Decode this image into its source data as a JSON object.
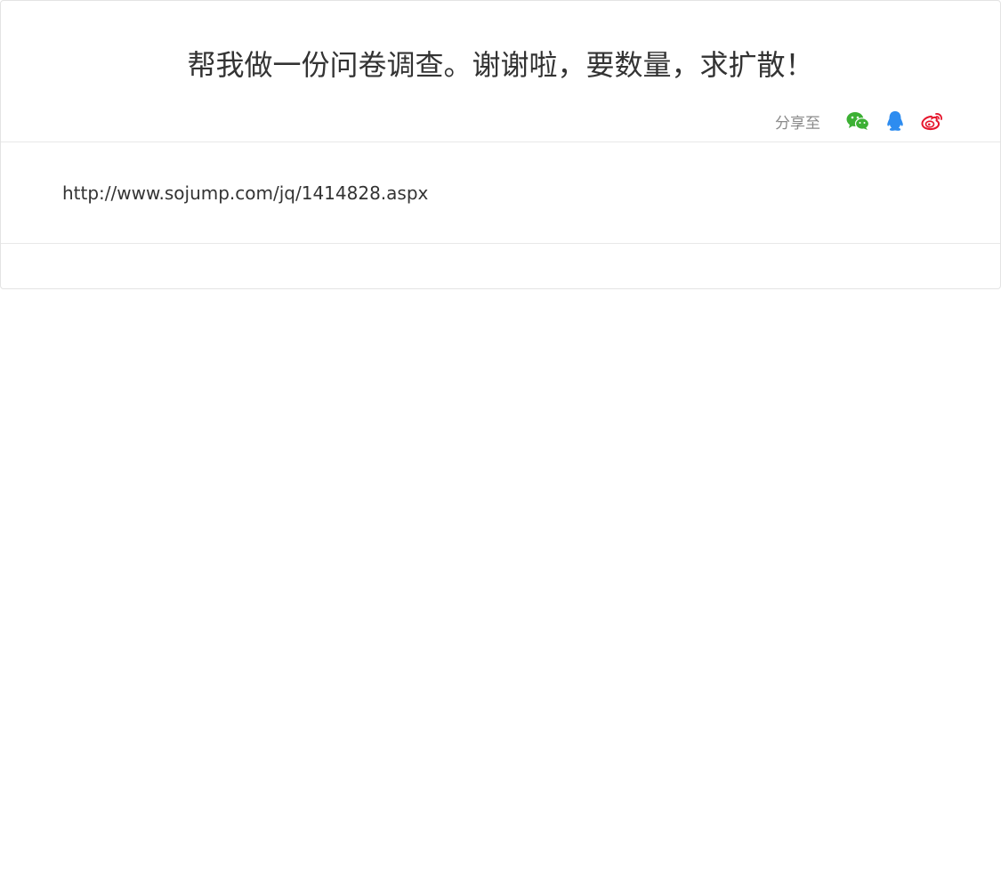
{
  "post": {
    "title": "帮我做一份问卷调查。谢谢啦，要数量，求扩散！",
    "share_label": "分享至",
    "share_targets": [
      {
        "icon": "wechat-icon",
        "color": "#3cb034"
      },
      {
        "icon": "qq-icon",
        "color": "#2d8cf0"
      },
      {
        "icon": "weibo-icon",
        "color": "#e6162d"
      }
    ],
    "content_link": "http://www.sojump.com/jq/1414828.aspx"
  }
}
